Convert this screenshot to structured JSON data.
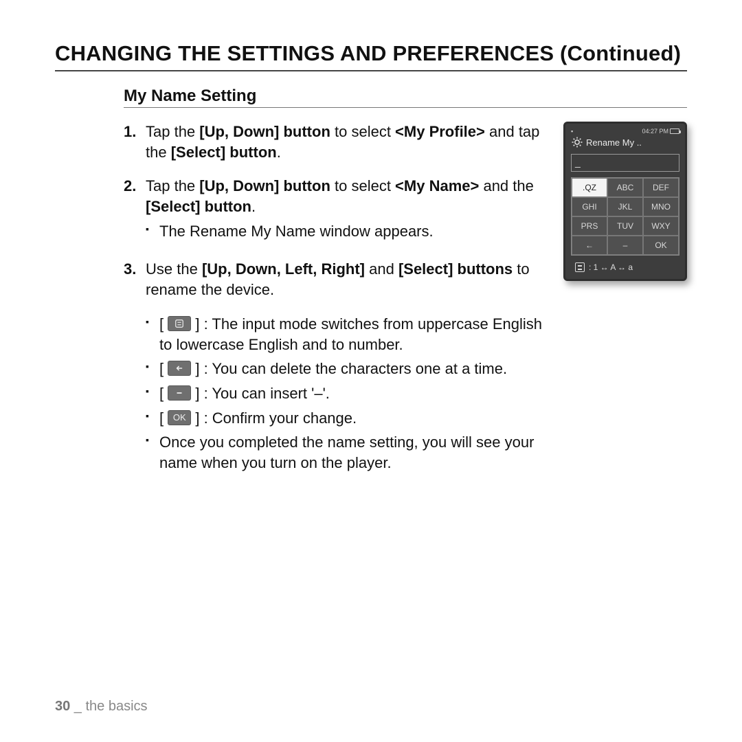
{
  "title": "CHANGING THE SETTINGS AND PREFERENCES (Continued)",
  "section": "My Name Setting",
  "steps": {
    "s1": {
      "num": "1.",
      "a": "Tap the ",
      "b": "[Up, Down] button",
      "c": " to select ",
      "d": "<My Profile>",
      "e": " and tap the ",
      "f": "[Select] button",
      "g": "."
    },
    "s2": {
      "num": "2.",
      "a": "Tap the ",
      "b": "[Up, Down] button",
      "c": " to select ",
      "d": "<My Name>",
      "e": " and the ",
      "f": "[Select] button",
      "g": ".",
      "sub1": "The Rename My Name window appears."
    },
    "s3": {
      "num": "3.",
      "a": "Use the ",
      "b": "[Up, Down, Left, Right]",
      "c": " and ",
      "d": "[Select] buttons",
      "e": " to rename the device.",
      "b1a": "[ ",
      "b1b": " ] : The input mode switches from uppercase English to lowercase English and to number.",
      "b2a": "[ ",
      "b2b": " ] : You can delete the characters one at a time.",
      "b3a": "[ ",
      "b3b": " ] : You can insert '–'.",
      "b4a": "[ ",
      "b4b": " ] : Confirm your change.",
      "b4key": "OK",
      "b5": "Once you completed the name setting, you will see your name when you turn on the player."
    }
  },
  "device": {
    "time": "04:27 PM",
    "title": "Rename My ..",
    "cursor": "_",
    "keys": [
      ".QZ",
      "ABC",
      "DEF",
      "GHI",
      "JKL",
      "MNO",
      "PRS",
      "TUV",
      "WXY",
      "←",
      "–",
      "OK"
    ],
    "mode": ": 1 ↔ A ↔ a"
  },
  "footer": {
    "page": "30",
    "sep": " _ ",
    "chapter": "the basics"
  }
}
